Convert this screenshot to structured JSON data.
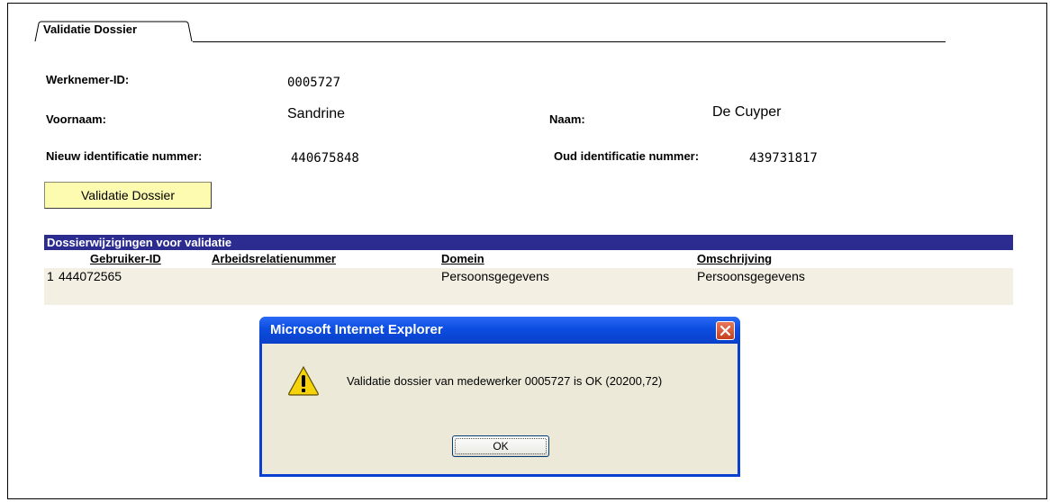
{
  "tab": {
    "label": "Validatie Dossier"
  },
  "form": {
    "werknemer_id_label": "Werknemer-ID:",
    "werknemer_id_value": "0005727",
    "voornaam_label": "Voornaam:",
    "voornaam_value": "Sandrine",
    "naam_label": "Naam:",
    "naam_value": "De Cuyper",
    "nieuw_id_label": "Nieuw identificatie nummer:",
    "nieuw_id_value": "440675848",
    "oud_id_label": "Oud identificatie nummer:",
    "oud_id_value": "439731817"
  },
  "validate_button": {
    "label": "Validatie Dossier"
  },
  "grid": {
    "title": "Dossierwijzigingen voor validatie",
    "columns": [
      "Gebruiker-ID",
      "Arbeidsrelatienummer",
      "Domein",
      "Omschrijving"
    ],
    "rows": [
      {
        "num": "1",
        "gebruiker_id": "444072565",
        "arbeidsrelatienummer": "",
        "domein": "Persoonsgegevens",
        "omschrijving": "Persoonsgegevens"
      }
    ]
  },
  "dialog": {
    "title": "Microsoft Internet Explorer",
    "message": "Validatie dossier van medewerker 0005727 is OK (20200,72)",
    "ok_label": "OK"
  },
  "colors": {
    "grid_header_bg": "#2b2b90",
    "row_bg": "#f3f0e3",
    "button_bg": "#fdfbb0",
    "dialog_title": "#0b4de0",
    "dialog_body": "#ece9d8"
  }
}
